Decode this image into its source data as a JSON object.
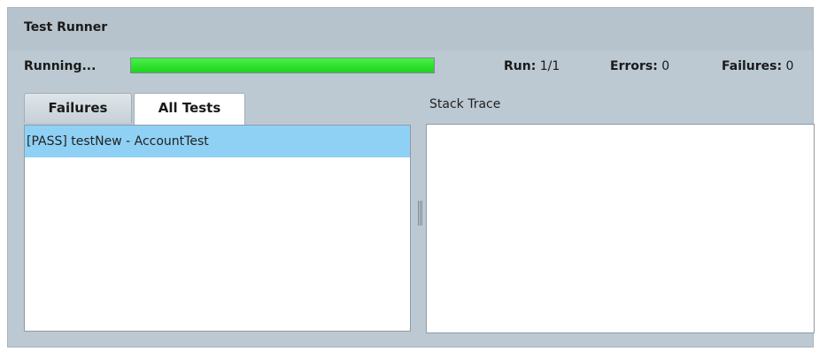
{
  "window": {
    "title": "Test Runner"
  },
  "status": {
    "running_label": "Running...",
    "progress_fraction": 1.0,
    "run_label": "Run:",
    "run_value": "1/1",
    "errors_label": "Errors:",
    "errors_value": "0",
    "failures_label": "Failures:",
    "failures_value": "0",
    "progress_color": "#2ee02e"
  },
  "tabs": [
    {
      "label": "Failures",
      "active": false
    },
    {
      "label": "All Tests",
      "active": true
    }
  ],
  "tests": [
    {
      "text": "[PASS] testNew - AccountTest",
      "selected": true
    }
  ],
  "stack_trace": {
    "label": "Stack Trace",
    "content": ""
  },
  "colors": {
    "panel_bg": "#bcc9d2",
    "selection": "#8fd1f5"
  }
}
